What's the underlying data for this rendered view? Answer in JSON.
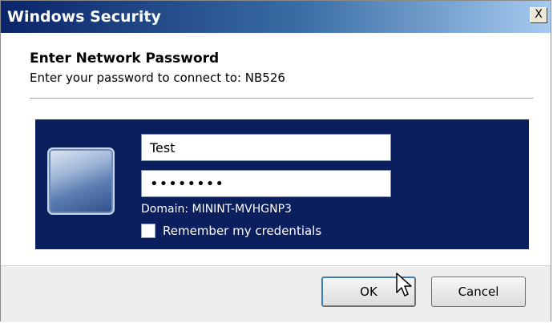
{
  "window": {
    "title": "Windows Security",
    "close_label": "X"
  },
  "header": {
    "heading": "Enter Network Password",
    "subheading": "Enter your password to connect to: NB526"
  },
  "credentials": {
    "tile_icon": "user-tile-icon",
    "username_value": "Test",
    "password_value": "••••••••",
    "domain_text": "Domain: MININT-MVHGNP3",
    "remember_label": "Remember my credentials",
    "remember_checked": false
  },
  "buttons": {
    "ok_label": "OK",
    "cancel_label": "Cancel"
  },
  "colors": {
    "panel_bg": "#0b1e5e",
    "titlebar_start": "#0a246a",
    "titlebar_end": "#a6caf0"
  }
}
